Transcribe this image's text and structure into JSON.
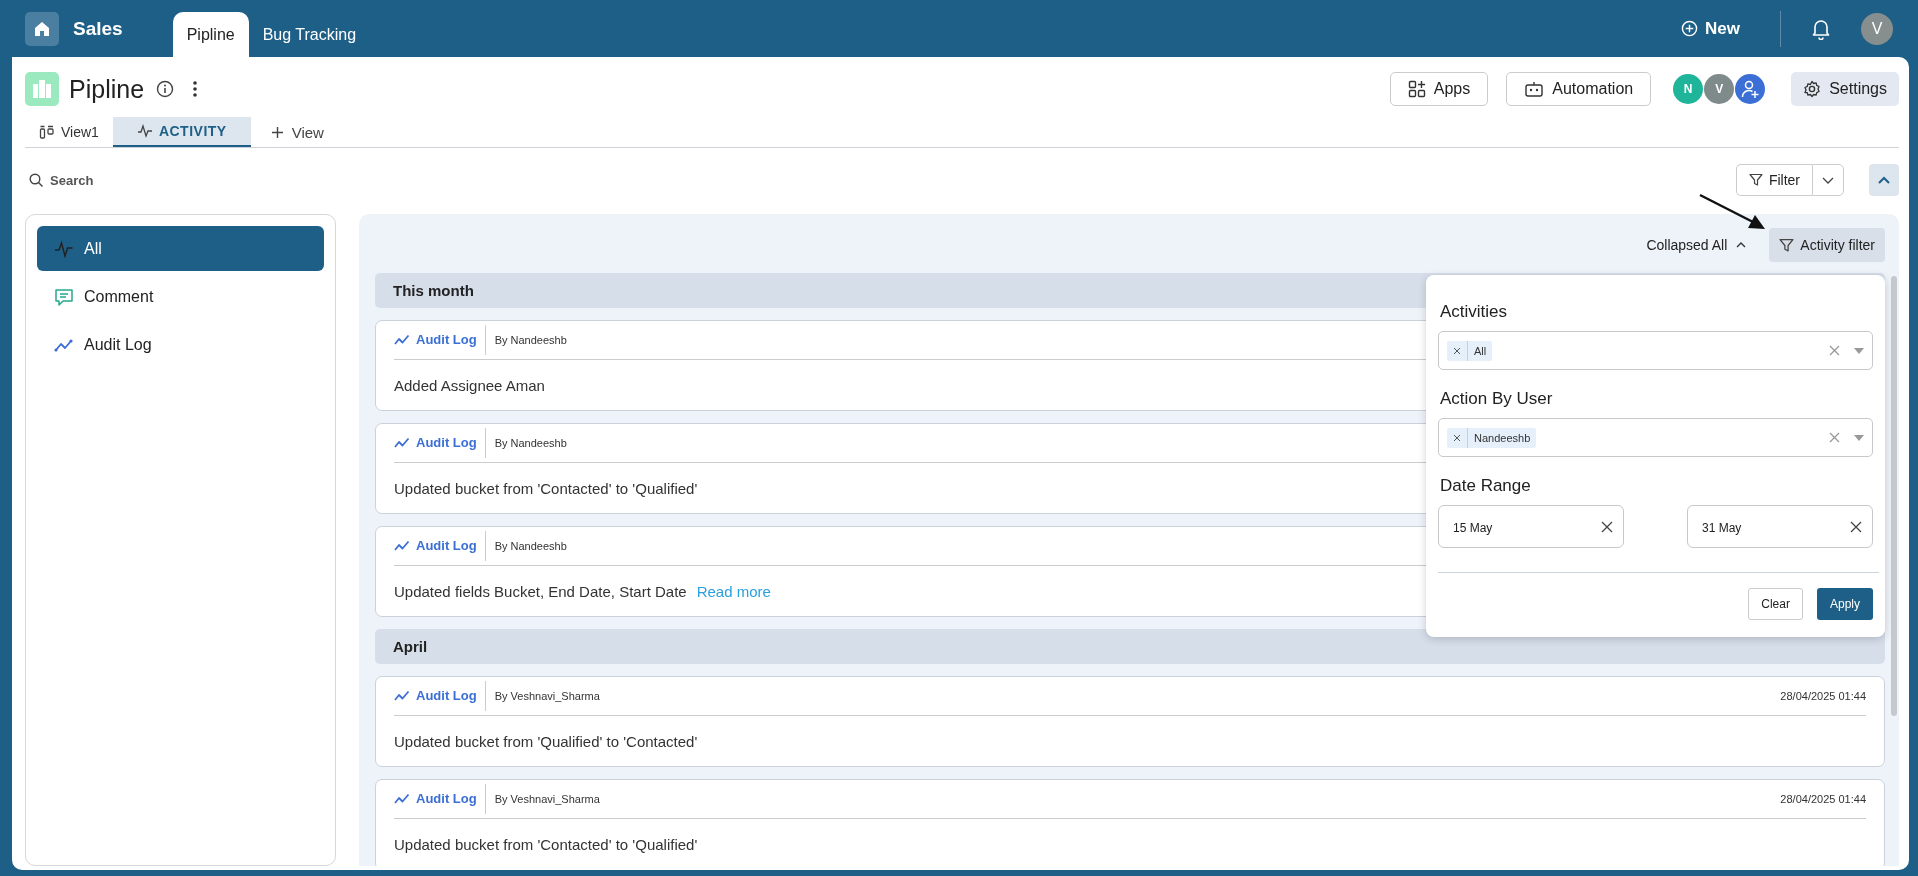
{
  "app": {
    "title": "Sales",
    "tabs": [
      {
        "label": "Pipline",
        "selected": true
      },
      {
        "label": "Bug Tracking",
        "selected": false
      }
    ],
    "new_button": "New",
    "user_avatar": "V"
  },
  "page": {
    "title": "Pipline",
    "buttons": [
      {
        "label": "Apps",
        "kind": "apps"
      },
      {
        "label": "Automation",
        "kind": "automation"
      }
    ],
    "members": [
      {
        "initial": "N",
        "color": "#1fb59a"
      },
      {
        "initial": "V",
        "color": "#7f8a8a"
      }
    ],
    "settings_button": "Settings",
    "view_tabs": [
      {
        "label": "View1",
        "kind": "board",
        "selected": false
      },
      {
        "label": "ACTIVITY",
        "kind": "activity",
        "selected": true
      }
    ],
    "add_view": "View",
    "search": {
      "placeholder": "Search"
    },
    "filter_button": "Filter"
  },
  "sidebar": {
    "items": [
      {
        "label": "All",
        "kind": "all",
        "selected": true
      },
      {
        "label": "Comment",
        "kind": "comment",
        "selected": false
      },
      {
        "label": "Audit Log",
        "kind": "audit",
        "selected": false
      }
    ]
  },
  "feed": {
    "collapse_label": "Collapsed All",
    "filter_button": "Activity filter",
    "groups": [
      {
        "title": "This month",
        "entries": [
          {
            "type_label": "Audit Log",
            "by": "By Nandeeshb",
            "text": "Added Assignee Aman"
          },
          {
            "type_label": "Audit Log",
            "by": "By Nandeeshb",
            "text": "Updated bucket from 'Contacted' to 'Qualified'"
          },
          {
            "type_label": "Audit Log",
            "by": "By Nandeeshb",
            "text": "Updated fields Bucket, End Date, Start Date",
            "link": "Read more"
          }
        ]
      },
      {
        "title": "April",
        "entries": [
          {
            "type_label": "Audit Log",
            "by": "By Veshnavi_Sharma",
            "date": "28/04/2025 01:44",
            "text": "Updated bucket from 'Qualified' to 'Contacted'"
          },
          {
            "type_label": "Audit Log",
            "by": "By Veshnavi_Sharma",
            "date": "28/04/2025 01:44",
            "text": "Updated bucket from 'Contacted' to 'Qualified'"
          }
        ]
      }
    ]
  },
  "filter_panel": {
    "selects": [
      {
        "label": "Activities",
        "tags": [
          "All"
        ]
      },
      {
        "label": "Action By User",
        "tags": [
          "Nandeeshb"
        ]
      }
    ],
    "date_range": {
      "label": "Date Range",
      "from": "15 May",
      "to": "31 May"
    },
    "clear_button": "Clear",
    "apply_button": "Apply"
  }
}
